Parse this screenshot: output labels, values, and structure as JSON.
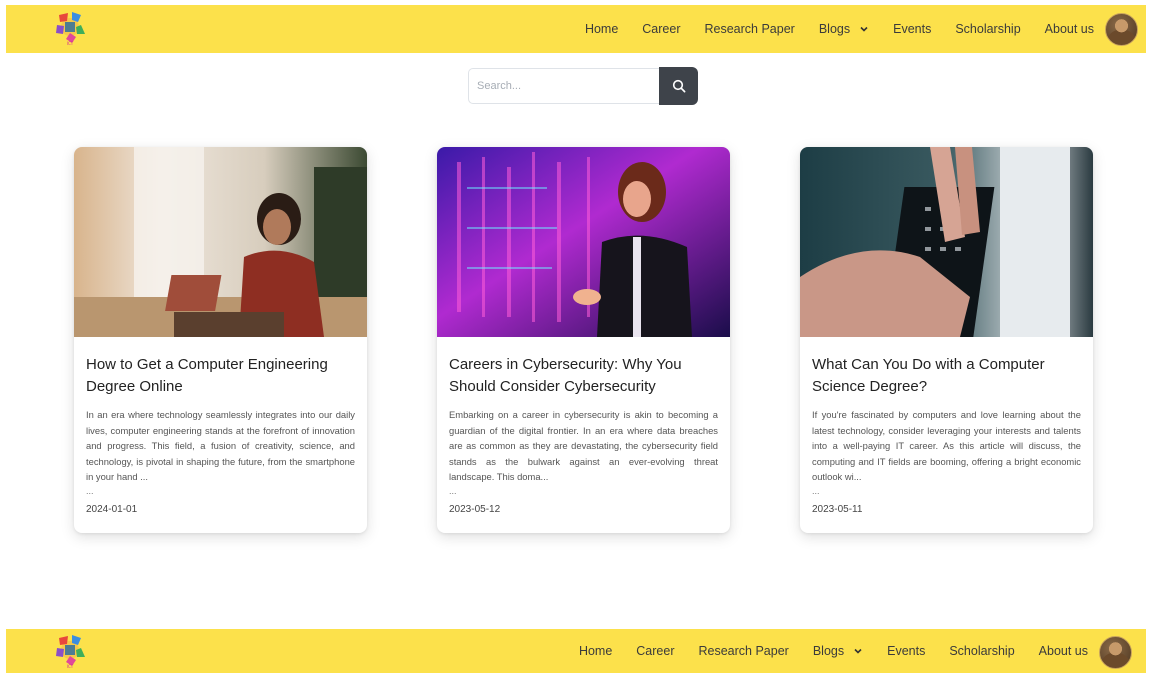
{
  "nav": {
    "links": [
      "Home",
      "Career",
      "Research Paper",
      "Blogs",
      "Events",
      "Scholarship",
      "About us"
    ]
  },
  "search": {
    "placeholder": "Search..."
  },
  "posts": [
    {
      "title": "How to Get a Computer Engineering Degree Online",
      "excerpt": "In an era where technology seamlessly integrates into our daily lives, computer engineering stands at the forefront of innovation and progress. This field, a fusion of creativity, science, and technology, is pivotal in shaping the future, from the smartphone in your hand ...",
      "ellipsis": "...",
      "date": "2024-01-01"
    },
    {
      "title": "Careers in Cybersecurity: Why You Should Consider Cybersecurity",
      "excerpt": "Embarking on a career in cybersecurity is akin to becoming a guardian of the digital frontier. In an era where data breaches are as common as they are devastating, the cybersecurity field stands as the bulwark against an ever-evolving threat landscape. This doma...",
      "ellipsis": "...",
      "date": "2023-05-12"
    },
    {
      "title": "What Can You Do with a Computer Science Degree?",
      "excerpt": "If you're fascinated by computers and love learning about the latest technology, consider leveraging your interests and talents into a well-paying IT career. As this article will discuss, the computing and IT fields are booming, offering a bright economic outlook wi...",
      "ellipsis": "...",
      "date": "2023-05-11"
    }
  ],
  "footer": {
    "links": [
      "Home",
      "Career",
      "Research Paper",
      "Blogs",
      "Events",
      "Scholarship",
      "About us"
    ]
  },
  "colors": {
    "navbar": "#fce14b",
    "search_button": "#3e434a"
  }
}
